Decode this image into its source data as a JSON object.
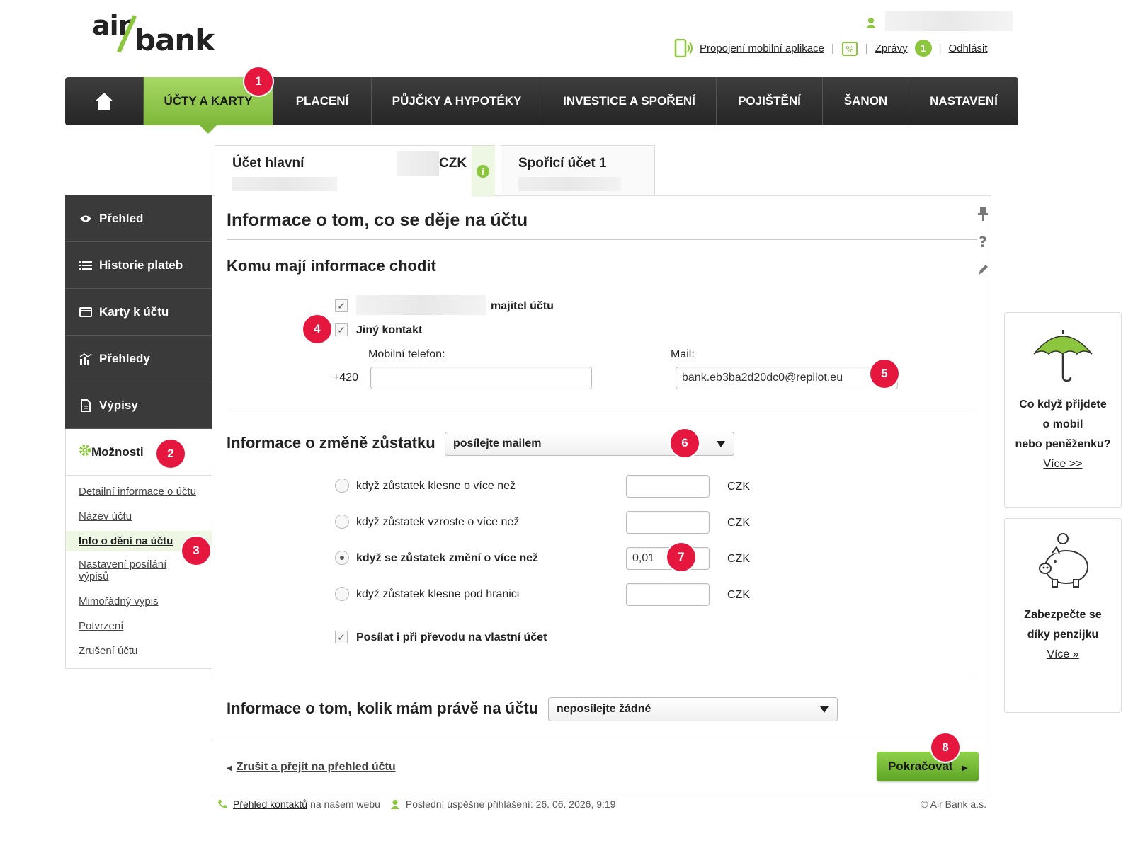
{
  "logo": {
    "part1": "air",
    "part2": "bank"
  },
  "header": {
    "links": [
      {
        "label": "Propojení mobilní aplikace"
      },
      {
        "label": "Zprávy",
        "badge": "1"
      },
      {
        "label": "Odhlásit"
      }
    ]
  },
  "nav": {
    "items": [
      "ÚČTY A KARTY",
      "PLACENÍ",
      "PŮJČKY A HYPOTÉKY",
      "INVESTICE A SPOŘENÍ",
      "POJIŠTĚNÍ",
      "ŠANON",
      "NASTAVENÍ"
    ]
  },
  "accounts": {
    "tab1": {
      "name": "Účet hlavní",
      "currency": "CZK"
    },
    "tab2": {
      "name": "Spořicí účet 1"
    }
  },
  "sidebar": {
    "items": [
      "Přehled",
      "Historie plateb",
      "Karty k účtu",
      "Přehledy",
      "Výpisy"
    ],
    "active": "Možnosti",
    "sub": [
      "Detailní informace o účtu",
      "Název účtu",
      "Info o dění na účtu",
      "Nastavení posílání výpisů",
      "Mimořádný výpis",
      "Potvrzení",
      "Zrušení účtu"
    ]
  },
  "content": {
    "title": "Informace o tom, co se děje na účtu",
    "recipients": {
      "heading": "Komu mají informace chodit",
      "owner_label": "majitel účtu",
      "other_label": "Jiný kontakt",
      "phone_label": "Mobilní telefon:",
      "phone_prefix": "+420",
      "phone_value": "",
      "mail_label": "Mail:",
      "mail_value": "bank.eb3ba2d20dc0@repilot.eu"
    },
    "balance_change": {
      "heading": "Informace o změně zůstatku",
      "select_value": "posílejte mailem",
      "options": [
        {
          "label": "když zůstatek klesne o více než",
          "value": "",
          "currency": "CZK",
          "selected": false
        },
        {
          "label": "když zůstatek vzroste o více než",
          "value": "",
          "currency": "CZK",
          "selected": false
        },
        {
          "label": "když se zůstatek změní o více než",
          "value": "0,01",
          "currency": "CZK",
          "selected": true
        },
        {
          "label": "když zůstatek klesne pod hranici",
          "value": "",
          "currency": "CZK",
          "selected": false
        }
      ],
      "own_transfer_label": "Posílat i při převodu na vlastní účet"
    },
    "balance_info": {
      "heading": "Informace o tom, kolik mám právě na účtu",
      "select_value": "neposílejte žádné"
    },
    "cancel_link": "Zrušit a přejít na přehled účtu",
    "continue_button": "Pokračovat"
  },
  "promos": [
    {
      "line1": "Co když přijdete",
      "line2": "o mobil",
      "line3": "nebo peněženku?",
      "link": "Více >>"
    },
    {
      "line1": "Zabezpečte se",
      "line2": "díky penzijku",
      "link": "Více »"
    }
  ],
  "footer": {
    "contacts_link": "Přehled kontaktů",
    "contacts_rest": "na našem webu",
    "last_login": "Poslední úspěšné přihlášení: 26. 06. 2026, 9:19",
    "copyright": "© Air Bank a.s."
  },
  "markers": [
    "1",
    "2",
    "3",
    "4",
    "5",
    "6",
    "7",
    "8"
  ],
  "colors": {
    "brand_green": "#8cc63f",
    "marker_red": "#e5173f",
    "nav_dark": "#333333"
  }
}
